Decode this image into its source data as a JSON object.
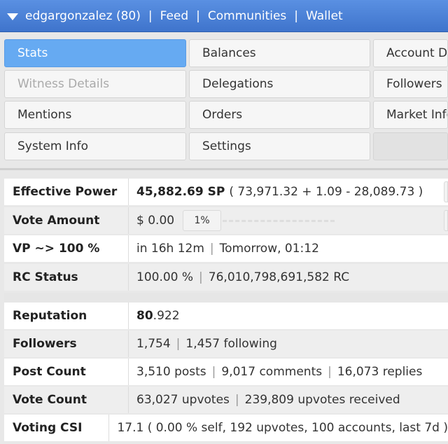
{
  "topbar": {
    "user": "edgargonzalez (80)",
    "links": [
      "Feed",
      "Communities",
      "Wallet"
    ],
    "separator": "|"
  },
  "tabs": {
    "stats": "Stats",
    "balances": "Balances",
    "account_details": "Account Details",
    "witness_details": "Witness Details",
    "delegations": "Delegations",
    "followers": "Followers",
    "mentions": "Mentions",
    "orders": "Orders",
    "market_info": "Market Info",
    "system_info": "System Info",
    "settings": "Settings"
  },
  "stats": {
    "effective_power": {
      "label": "Effective Power",
      "sp": "45,882.69 SP",
      "detail": "( 73,971.32 + 1.09 - 28,089.73 )"
    },
    "vote_amount": {
      "label": "Vote Amount",
      "value": "$ 0.00",
      "percent": "1%"
    },
    "vp": {
      "label": "VP ~> 100 %",
      "eta": "in 16h 12m",
      "when": "Tomorrow, 01:12"
    },
    "rc_status": {
      "label": "RC Status",
      "percent": "100.00 %",
      "rc": "76,010,798,691,582 RC"
    },
    "reputation": {
      "label": "Reputation",
      "int": "80",
      "dec": ".922"
    },
    "followers": {
      "label": "Followers",
      "count": "1,754",
      "following": "1,457 following"
    },
    "post_count": {
      "label": "Post Count",
      "posts": "3,510 posts",
      "comments": "9,017 comments",
      "replies": "16,073 replies"
    },
    "vote_count": {
      "label": "Vote Count",
      "upvotes": "63,027 upvotes",
      "received": "239,809 upvotes received"
    },
    "voting_csi": {
      "label": "Voting CSI",
      "value": "17.1 ( 0.00 % self, 192 upvotes, 100 accounts, last 7d )"
    }
  }
}
